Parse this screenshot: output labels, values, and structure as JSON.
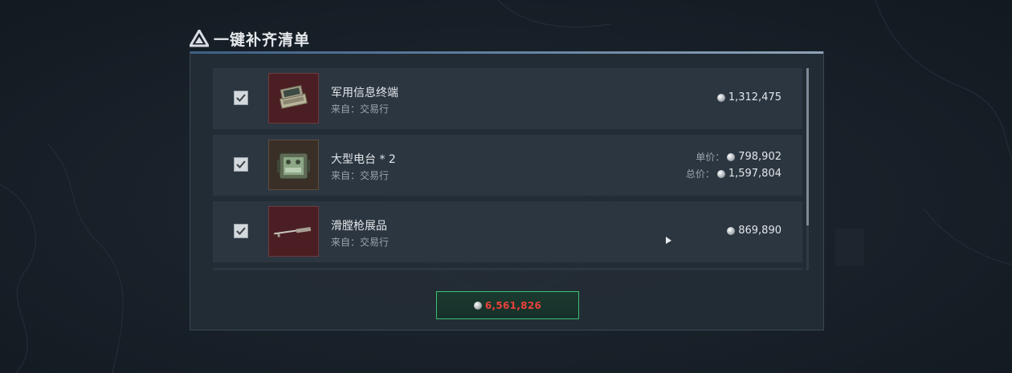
{
  "dialog": {
    "title": "一键补齐清单",
    "accent_color": "#3fbf74",
    "total_color": "#e8423b"
  },
  "items": [
    {
      "name": "军用信息终端",
      "source": "来自：交易行",
      "checked": true,
      "icon": "military-terminal-icon",
      "price": "1,312,475"
    },
    {
      "name": "大型电台 * 2",
      "source": "来自：交易行",
      "checked": true,
      "icon": "radio-station-icon",
      "unit_label": "单价：",
      "unit_price": "798,902",
      "total_label": "总价：",
      "total_price": "1,597,804"
    },
    {
      "name": "滑膛枪展品",
      "source": "来自：交易行",
      "checked": true,
      "icon": "musket-icon",
      "price": "869,890"
    }
  ],
  "footer": {
    "total": "6,561,826",
    "coin_icon": "coin-icon"
  }
}
